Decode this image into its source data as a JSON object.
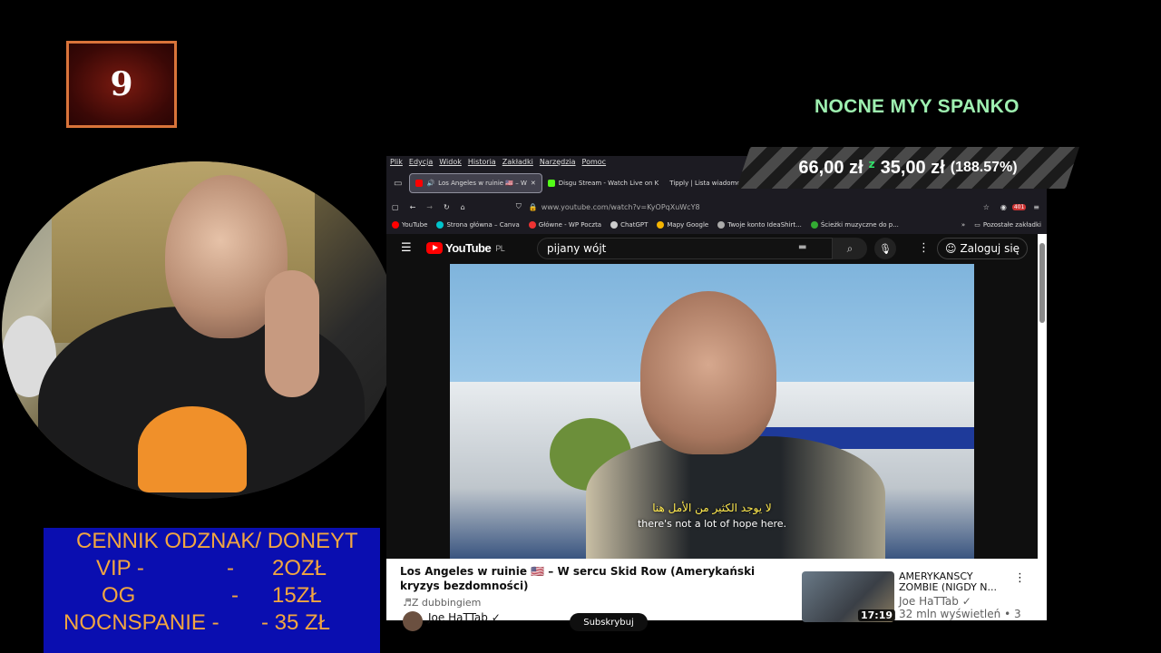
{
  "badge": {
    "number": "9"
  },
  "stream_title": "NOCNE MYY SPANKO",
  "ticker": {
    "current": "66,00 zł",
    "icon": "z",
    "goal": "35,00 zł",
    "percent": "(188.57%)"
  },
  "cennik": {
    "heading": "CENNIK ODZNAK/ DONEYT",
    "rows": [
      {
        "name": "VIP -",
        "sep": "-",
        "price": "2OZŁ"
      },
      {
        "name": "OG",
        "sep": "-",
        "price": "15ZŁ"
      },
      {
        "name": "NOCNSPANIE -",
        "sep": "- 35 ZŁ",
        "price": ""
      }
    ]
  },
  "browser": {
    "menu": [
      "Plik",
      "Edycja",
      "Widok",
      "Historia",
      "Zakładki",
      "Narzędzia",
      "Pomoc"
    ],
    "tabs": [
      {
        "label": "Los Angeles w ruinie 🇺🇸 – W",
        "color": "#ff0000",
        "active": true
      },
      {
        "label": "Disgu Stream - Watch Live on K",
        "color": "#53fc18",
        "active": false
      },
      {
        "label": "Tipply | Lista wiadomo",
        "color": "#888888",
        "active": false
      }
    ],
    "url": "www.youtube.com/watch?v=KyOPqXuWcY8",
    "badge_count": "401",
    "bookmarks": [
      "YouTube",
      "Strona główna – Canva",
      "Główne - WP Poczta",
      "ChatGPT",
      "Mapy Google",
      "Twoje konto IdeaShirt...",
      "Ścieżki muzyczne do p..."
    ],
    "other_bookmarks": "Pozostałe zakładki"
  },
  "youtube": {
    "logo": "YouTube",
    "region": "PL",
    "search_value": "pijany wójt",
    "login": "Zaloguj się",
    "subtitle_ar": "لا يوجد الكثير من الأمل هنا",
    "subtitle_en": "there's not a lot of hope here.",
    "video_title": "Los Angeles w ruinie 🇺🇸 – W sercu Skid Row (Amerykański kryzys bezdomności)",
    "dubbing": "Z dubbingiem",
    "channel": "Joe HaTTab ✓",
    "subscribe": "Subskrybuj",
    "related": {
      "title": "AMERYKANSCY ZOMBIE (NIGDY N...",
      "channel": "Joe HaTTab ✓",
      "views": "32 mln wyświetleń • 3",
      "duration": "17:19"
    }
  }
}
